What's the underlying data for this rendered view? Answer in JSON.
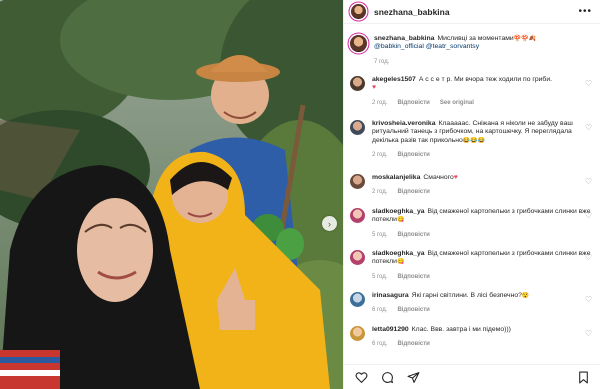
{
  "header": {
    "username": "snezhana_babkina",
    "more_icon": "more-horizontal-icon"
  },
  "caption": {
    "username": "snezhana_babkina",
    "text": "Мисливці за моментами",
    "emoji": "🍄🍄🍂",
    "mentions": "@babkin_official @teatr_sorvantsy",
    "time": "7 год."
  },
  "comments": [
    {
      "username": "akegeles1507",
      "text": "А с с е т р. Ми вчора теж ходили по гриби.",
      "emoji": "♥",
      "time": "2 год.",
      "reply": "Відповісти",
      "translate": "See original"
    },
    {
      "username": "krivosheia.veronika",
      "text": "Клааааас. Сніжана я ніколи не забуду ваш ритуальний танець з грибочком, на картошечку. Я переглядала декілька разів так прикольно",
      "emoji": "😂😂😂",
      "time": "2 год.",
      "reply": "Відповісти"
    },
    {
      "username": "moskalanjelika",
      "text": "Смачного",
      "emoji": "♥",
      "time": "2 год.",
      "reply": "Відповісти"
    },
    {
      "username": "sladkoeghka_ya",
      "text": "Від смаженої картопельки з грибочками слинки вже потекли",
      "emoji": "😋",
      "time": "5 год.",
      "reply": "Відповісти"
    },
    {
      "username": "sladkoeghka_ya",
      "text": "Від смаженої картопельки з грибочками слинки вже потекли",
      "emoji": "😋",
      "time": "5 год.",
      "reply": "Відповісти"
    },
    {
      "username": "irinasagura",
      "text": "Які гарні світлини. В лісі безпечно?",
      "emoji": "😯",
      "time": "6 год.",
      "reply": "Відповісти"
    },
    {
      "username": "letta091290",
      "text": "Клас. Ввв. завтра і ми підемо)))",
      "emoji": "",
      "time": "6 год.",
      "reply": "Відповісти"
    }
  ],
  "actions": {
    "like": "heart-icon",
    "comment": "comment-icon",
    "share": "share-icon",
    "save": "bookmark-icon"
  },
  "colors": {
    "story_ring": "#d6249f",
    "link": "#00376b",
    "meta": "#8e8e8e",
    "photo_forest": "#4a6a3e",
    "raincoat": "#f2b318"
  }
}
